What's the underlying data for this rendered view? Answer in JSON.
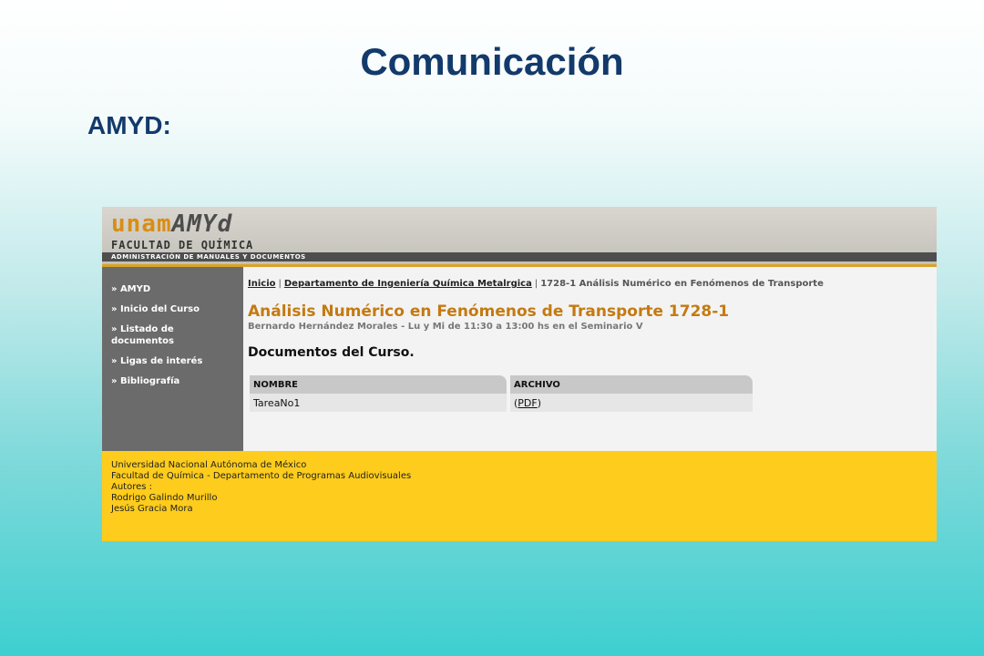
{
  "slide": {
    "title": "Comunicación",
    "subtitle": "AMYD:"
  },
  "site": {
    "logo_a": "unam",
    "logo_b": "AMYd",
    "faculty": "FACULTAD DE QUÍMICA",
    "admin_bar": "ADMINISTRACIÓN DE MANUALES Y DOCUMENTOS"
  },
  "sidebar": {
    "items": [
      {
        "label": "» AMYD"
      },
      {
        "label": "» Inicio del Curso"
      },
      {
        "label": "» Listado de documentos"
      },
      {
        "label": "» Ligas de interés"
      },
      {
        "label": "» Bibliografía"
      }
    ]
  },
  "breadcrumb": {
    "home": "Inicio",
    "separator": "|",
    "department": "Departamento de Ingeniería Química Metalrgica",
    "current": "1728-1 Análisis Numérico en Fenómenos de Transporte"
  },
  "course": {
    "title": "Análisis Numérico en Fenómenos de Transporte 1728-1",
    "info": "Bernardo Hernández Morales - Lu y Mi de 11:30 a 13:00 hs en el Seminario V"
  },
  "documents": {
    "heading": "Documentos del Curso.",
    "columns": [
      "NOMBRE",
      "ARCHIVO"
    ],
    "rows": [
      {
        "name": "TareaNo1",
        "file_prefix": "(",
        "file_link": "PDF",
        "file_suffix": ")"
      }
    ]
  },
  "footer": {
    "lines": [
      "Universidad Nacional Autónoma de México",
      "Facultad de Química - Departamento de Programas Audiovisuales",
      "Autores :",
      "Rodrigo Galindo Murillo",
      "Jesús Gracia Mora"
    ]
  },
  "colors": {
    "title_blue": "#123a6b",
    "accent_orange": "#c47a11",
    "sidebar_gray": "#6b6b6b",
    "footer_yellow": "#fdcc1c"
  }
}
